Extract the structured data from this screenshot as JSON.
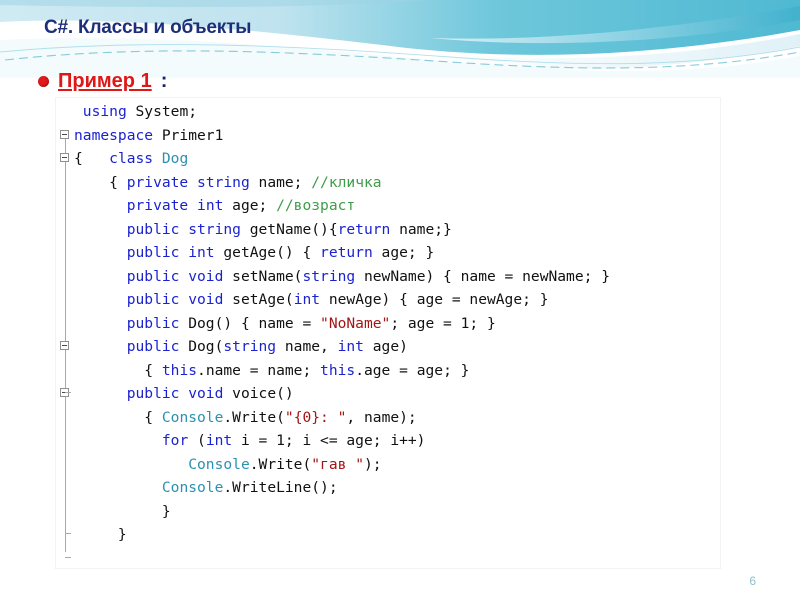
{
  "slide": {
    "title": "C#. Классы и объекты",
    "page_number": "6",
    "accent_color": "#2b91af",
    "title_color": "#1b2f7a",
    "bullet_color": "#e01b1b"
  },
  "bullet": {
    "label": "Пример 1",
    "colon": ":"
  },
  "code": {
    "language": "csharp",
    "colors": {
      "keyword": "#1b23d0",
      "type": "#2b91af",
      "string": "#a31515",
      "comment": "#3f9d49",
      "plain": "#111111"
    },
    "lines": [
      [
        {
          "t": " ",
          "c": "pl"
        },
        {
          "t": "using",
          "c": "kw"
        },
        {
          "t": " System;",
          "c": "pl"
        }
      ],
      [
        {
          "t": "namespace",
          "c": "kw"
        },
        {
          "t": " Primer1",
          "c": "pl"
        }
      ],
      [
        {
          "t": "{   ",
          "c": "pl"
        },
        {
          "t": "class",
          "c": "kw"
        },
        {
          "t": " ",
          "c": "pl"
        },
        {
          "t": "Dog",
          "c": "ty"
        }
      ],
      [
        {
          "t": "    { ",
          "c": "pl"
        },
        {
          "t": "private",
          "c": "kw"
        },
        {
          "t": " ",
          "c": "pl"
        },
        {
          "t": "string",
          "c": "kw"
        },
        {
          "t": " name; ",
          "c": "pl"
        },
        {
          "t": "//кличка",
          "c": "cm"
        }
      ],
      [
        {
          "t": "      ",
          "c": "pl"
        },
        {
          "t": "private",
          "c": "kw"
        },
        {
          "t": " ",
          "c": "pl"
        },
        {
          "t": "int",
          "c": "kw"
        },
        {
          "t": " age; ",
          "c": "pl"
        },
        {
          "t": "//возраст",
          "c": "cm"
        }
      ],
      [
        {
          "t": "      ",
          "c": "pl"
        },
        {
          "t": "public",
          "c": "kw"
        },
        {
          "t": " ",
          "c": "pl"
        },
        {
          "t": "string",
          "c": "kw"
        },
        {
          "t": " getName(){",
          "c": "pl"
        },
        {
          "t": "return",
          "c": "kw"
        },
        {
          "t": " name;}",
          "c": "pl"
        }
      ],
      [
        {
          "t": "      ",
          "c": "pl"
        },
        {
          "t": "public",
          "c": "kw"
        },
        {
          "t": " ",
          "c": "pl"
        },
        {
          "t": "int",
          "c": "kw"
        },
        {
          "t": " getAge() { ",
          "c": "pl"
        },
        {
          "t": "return",
          "c": "kw"
        },
        {
          "t": " age; }",
          "c": "pl"
        }
      ],
      [
        {
          "t": "      ",
          "c": "pl"
        },
        {
          "t": "public",
          "c": "kw"
        },
        {
          "t": " ",
          "c": "pl"
        },
        {
          "t": "void",
          "c": "kw"
        },
        {
          "t": " setName(",
          "c": "pl"
        },
        {
          "t": "string",
          "c": "kw"
        },
        {
          "t": " newName) { name = newName; }",
          "c": "pl"
        }
      ],
      [
        {
          "t": "      ",
          "c": "pl"
        },
        {
          "t": "public",
          "c": "kw"
        },
        {
          "t": " ",
          "c": "pl"
        },
        {
          "t": "void",
          "c": "kw"
        },
        {
          "t": " setAge(",
          "c": "pl"
        },
        {
          "t": "int",
          "c": "kw"
        },
        {
          "t": " newAge) { age = newAge; }",
          "c": "pl"
        }
      ],
      [
        {
          "t": "      ",
          "c": "pl"
        },
        {
          "t": "public",
          "c": "kw"
        },
        {
          "t": " Dog() { name = ",
          "c": "pl"
        },
        {
          "t": "\"NoName\"",
          "c": "st"
        },
        {
          "t": "; age = 1; }",
          "c": "pl"
        }
      ],
      [
        {
          "t": "      ",
          "c": "pl"
        },
        {
          "t": "public",
          "c": "kw"
        },
        {
          "t": " Dog(",
          "c": "pl"
        },
        {
          "t": "string",
          "c": "kw"
        },
        {
          "t": " name, ",
          "c": "pl"
        },
        {
          "t": "int",
          "c": "kw"
        },
        {
          "t": " age)",
          "c": "pl"
        }
      ],
      [
        {
          "t": "        { ",
          "c": "pl"
        },
        {
          "t": "this",
          "c": "kw"
        },
        {
          "t": ".name = name; ",
          "c": "pl"
        },
        {
          "t": "this",
          "c": "kw"
        },
        {
          "t": ".age = age; }",
          "c": "pl"
        }
      ],
      [
        {
          "t": "      ",
          "c": "pl"
        },
        {
          "t": "public",
          "c": "kw"
        },
        {
          "t": " ",
          "c": "pl"
        },
        {
          "t": "void",
          "c": "kw"
        },
        {
          "t": " voice()",
          "c": "pl"
        }
      ],
      [
        {
          "t": "        { ",
          "c": "pl"
        },
        {
          "t": "Console",
          "c": "ty"
        },
        {
          "t": ".Write(",
          "c": "pl"
        },
        {
          "t": "\"{0}: \"",
          "c": "st"
        },
        {
          "t": ", name);",
          "c": "pl"
        }
      ],
      [
        {
          "t": "          ",
          "c": "pl"
        },
        {
          "t": "for",
          "c": "kw"
        },
        {
          "t": " (",
          "c": "pl"
        },
        {
          "t": "int",
          "c": "kw"
        },
        {
          "t": " i = 1; i <= age; i++)",
          "c": "pl"
        }
      ],
      [
        {
          "t": "             ",
          "c": "pl"
        },
        {
          "t": "Console",
          "c": "ty"
        },
        {
          "t": ".Write(",
          "c": "pl"
        },
        {
          "t": "\"гав \"",
          "c": "st"
        },
        {
          "t": ");",
          "c": "pl"
        }
      ],
      [
        {
          "t": "          ",
          "c": "pl"
        },
        {
          "t": "Console",
          "c": "ty"
        },
        {
          "t": ".WriteLine();",
          "c": "pl"
        }
      ],
      [
        {
          "t": "          }",
          "c": "pl"
        }
      ],
      [
        {
          "t": "     }",
          "c": "pl"
        }
      ]
    ],
    "fold_markers": [
      {
        "line": 1
      },
      {
        "line": 2
      },
      {
        "line": 10
      },
      {
        "line": 12
      }
    ]
  }
}
